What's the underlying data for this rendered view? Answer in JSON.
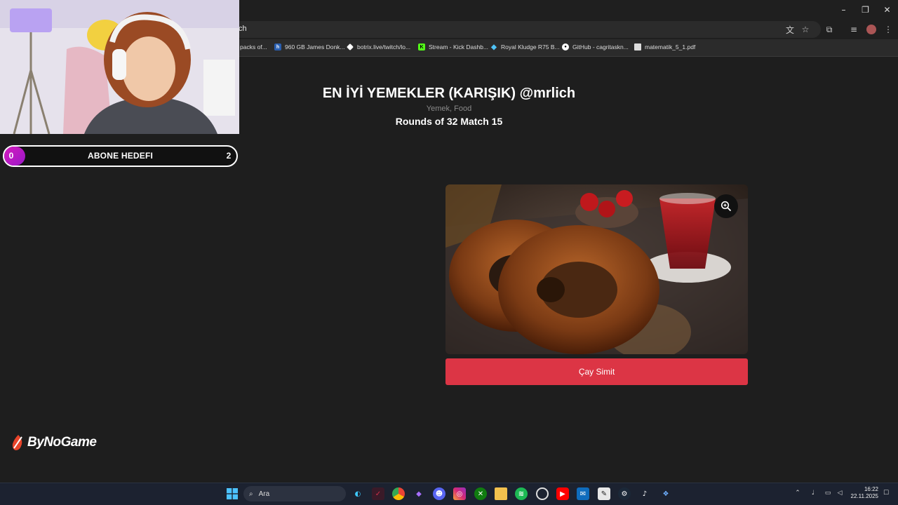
{
  "browser": {
    "address_text": "ch",
    "window_controls": {
      "minimize": "–",
      "restore": "❐",
      "close": "✕"
    },
    "bookmarks": [
      {
        "label": "packs of...",
        "icon": "folder-icon"
      },
      {
        "label": "960 GB James Donk...",
        "icon": "site-icon"
      },
      {
        "label": "botrix.live/twitch/lo...",
        "icon": "botrix-icon"
      },
      {
        "label": "Stream - Kick Dashb...",
        "icon": "kick-icon",
        "color": "#53fc18"
      },
      {
        "label": "Royal Kludge R75 B...",
        "icon": "gem-icon"
      },
      {
        "label": "GitHub - cagritaskn...",
        "icon": "github-icon"
      },
      {
        "label": "matematik_5_1.pdf",
        "icon": "pdf-icon"
      }
    ]
  },
  "page": {
    "title": "EN İYİ YEMEKLER (KARIŞIK) @mrlich",
    "subtitle": "Yemek, Food",
    "round": "Rounds of 32 Match 15",
    "choice": {
      "label": "Çay Simit",
      "color": "#dc3545"
    }
  },
  "overlay": {
    "sub_goal": {
      "label": "ABONE HEDEFI",
      "current": "0",
      "target": "2"
    },
    "sponsor": "ByNoGame"
  },
  "taskbar": {
    "search_placeholder": "Ara",
    "clock_time": "16:22",
    "clock_date": "22.11.2025"
  }
}
